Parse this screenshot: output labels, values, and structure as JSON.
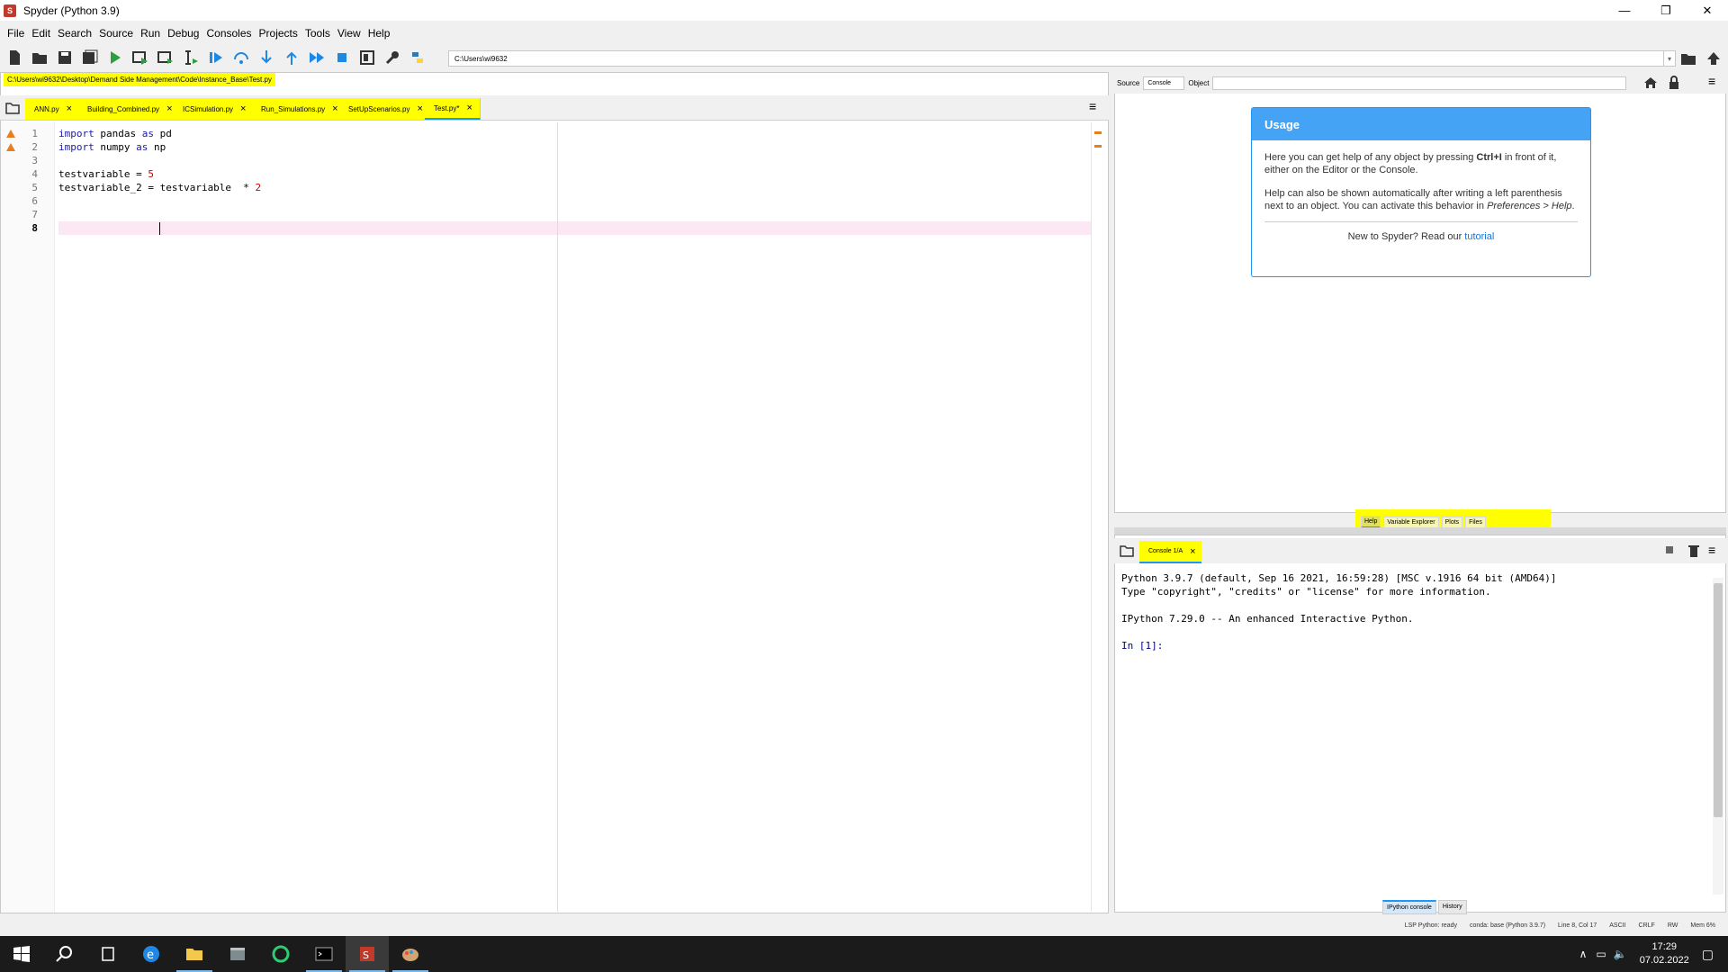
{
  "window": {
    "title": "Spyder (Python 3.9)",
    "app_icon": "spyder-icon",
    "minimize": "—",
    "maximize": "❐",
    "close": "✕"
  },
  "menu": [
    "File",
    "Edit",
    "Search",
    "Source",
    "Run",
    "Debug",
    "Consoles",
    "Projects",
    "Tools",
    "View",
    "Help"
  ],
  "toolbar": {
    "working_dir": "C:\\Users\\wi9632",
    "dropdown": "▾"
  },
  "editor": {
    "file_path": "C:\\Users\\wi9632\\Desktop\\Demand Side Management\\Code\\Instance_Base\\Test.py",
    "tabs": [
      {
        "label": "ANN.py",
        "close": "×"
      },
      {
        "label": "Building_Combined.py",
        "close": "×"
      },
      {
        "label": "ICSimulation.py",
        "close": "×"
      },
      {
        "label": "Run_Simulations.py",
        "close": "×"
      },
      {
        "label": "SetUpScenarios.py",
        "close": "×"
      },
      {
        "label": "Test.py*",
        "close": "×"
      }
    ],
    "line_numbers": [
      "1",
      "2",
      "3",
      "4",
      "5",
      "6",
      "7",
      "8"
    ],
    "lines": {
      "l1": {
        "kw1": "import",
        "a": " pandas ",
        "kw2": "as",
        "b": " pd"
      },
      "l2": {
        "kw1": "import",
        "a": " numpy ",
        "kw2": "as",
        "b": " np"
      },
      "l4": {
        "a": "testvariable = ",
        "n": "5"
      },
      "l5": {
        "a": "testvariable_2 = testvariable  * ",
        "n": "2"
      }
    },
    "options_icon": "≡"
  },
  "help": {
    "source_label": "Source",
    "source_value": "Console",
    "object_label": "Object",
    "object_value": "",
    "usage_title": "Usage",
    "p1_a": "Here you can get help of any object by pressing ",
    "p1_b": "Ctrl+I",
    "p1_c": " in front of it, either on the Editor or the Console.",
    "p2_a": "Help can also be shown automatically after writing a left parenthesis next to an object. You can activate this behavior in ",
    "p2_b": "Preferences > Help",
    "p2_c": ".",
    "new_a": "New to Spyder? Read our ",
    "new_link": "tutorial",
    "tabs": [
      "Help",
      "Variable Explorer",
      "Plots",
      "Files"
    ]
  },
  "console": {
    "tab_label": "Console 1/A",
    "tab_close": "×",
    "line1": "Python 3.9.7 (default, Sep 16 2021, 16:59:28) [MSC v.1916 64 bit (AMD64)]",
    "line2": "Type \"copyright\", \"credits\" or \"license\" for more information.",
    "line3": "IPython 7.29.0 -- An enhanced Interactive Python.",
    "prompt": "In [1]:",
    "bottom_tabs": [
      "IPython console",
      "History"
    ]
  },
  "status": {
    "lsp": "LSP Python: ready",
    "conda": "conda: base (Python 3.9.7)",
    "position": "Line 8, Col 17",
    "encoding": "ASCII",
    "eol": "CRLF",
    "rw": "RW",
    "mem": "Mem 6%"
  },
  "taskbar": {
    "time": "17:29",
    "date": "07.02.2022"
  },
  "colors": {
    "highlight": "#ffff00",
    "accent": "#2196f3",
    "warning": "#e67e22"
  }
}
